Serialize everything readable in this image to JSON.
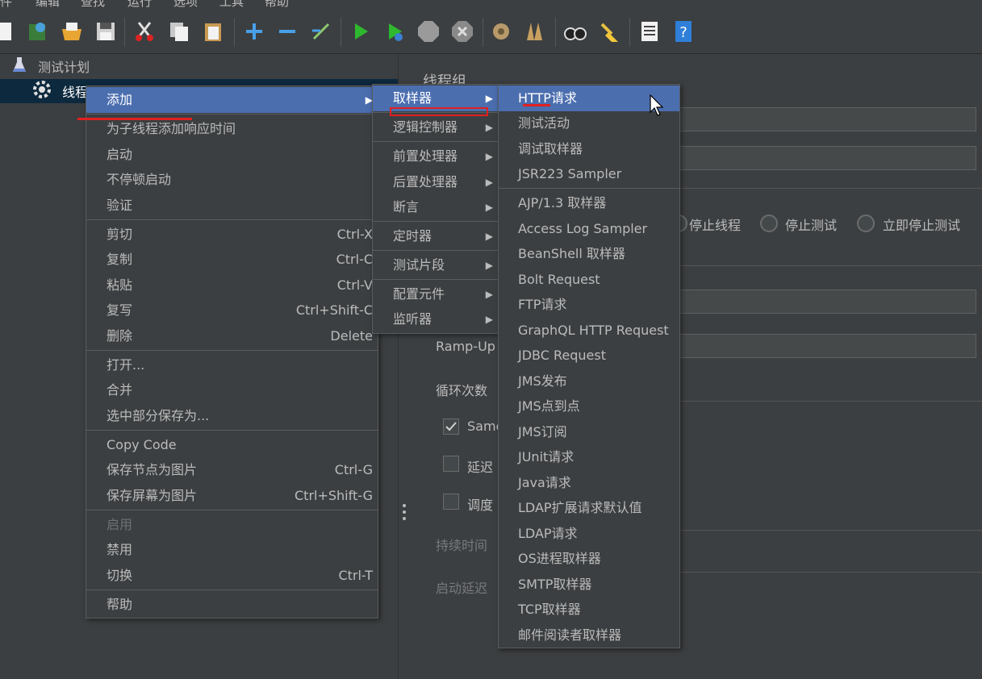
{
  "menubar": [
    "件",
    "编辑",
    "查找",
    "运行",
    "选项",
    "工具",
    "帮助"
  ],
  "toolbar": {
    "icons": [
      "new-icon",
      "templates-icon",
      "open-icon",
      "save-icon",
      "cut-icon",
      "copy-icon",
      "paste-icon",
      "expand-icon",
      "collapse-icon",
      "toggle-icon",
      "start-icon",
      "start-no-pause-icon",
      "stop-icon",
      "shutdown-icon",
      "clear-icon",
      "clear-all-icon",
      "search-icon",
      "reset-search-icon",
      "function-helper-icon",
      "help-icon"
    ]
  },
  "tree": {
    "root_label": "测试计划",
    "child_label": "线程组"
  },
  "right_panel": {
    "title": "线程组",
    "radio_stop_thread": "停止线程",
    "radio_stop_test": "停止测试",
    "radio_stop_test_now": "立即停止测试",
    "ramp_up_label": "Ramp-Up",
    "loop_label": "循环次数",
    "same_user_label": "Same",
    "delay_label": "延迟",
    "scheduler_label": "调度",
    "duration_label": "持续时间",
    "startup_delay_label": "启动延迟"
  },
  "context_menu": {
    "items": [
      {
        "label": "添加",
        "submenu": true,
        "selected": true
      },
      {
        "label": "为子线程添加响应时间"
      },
      {
        "label": "启动"
      },
      {
        "label": "不停顿启动"
      },
      {
        "label": "验证"
      },
      {
        "label": "剪切",
        "shortcut": "Ctrl-X"
      },
      {
        "label": "复制",
        "shortcut": "Ctrl-C"
      },
      {
        "label": "粘贴",
        "shortcut": "Ctrl-V"
      },
      {
        "label": "复写",
        "shortcut": "Ctrl+Shift-C"
      },
      {
        "label": "删除",
        "shortcut": "Delete"
      },
      {
        "label": "打开..."
      },
      {
        "label": "合并"
      },
      {
        "label": "选中部分保存为..."
      },
      {
        "label": "Copy Code"
      },
      {
        "label": "保存节点为图片",
        "shortcut": "Ctrl-G"
      },
      {
        "label": "保存屏幕为图片",
        "shortcut": "Ctrl+Shift-G"
      },
      {
        "label": "启用",
        "disabled": true
      },
      {
        "label": "禁用"
      },
      {
        "label": "切换",
        "shortcut": "Ctrl-T"
      },
      {
        "label": "帮助"
      }
    ]
  },
  "add_submenu": {
    "items": [
      {
        "label": "取样器",
        "selected": true
      },
      {
        "label": "逻辑控制器"
      },
      {
        "label": "前置处理器"
      },
      {
        "label": "后置处理器"
      },
      {
        "label": "断言"
      },
      {
        "label": "定时器"
      },
      {
        "label": "测试片段"
      },
      {
        "label": "配置元件"
      },
      {
        "label": "监听器"
      }
    ]
  },
  "sampler_submenu": {
    "items": [
      {
        "label": "HTTP请求",
        "selected": true
      },
      {
        "label": "测试活动"
      },
      {
        "label": "调试取样器"
      },
      {
        "label": "JSR223 Sampler"
      },
      {
        "label": "AJP/1.3 取样器"
      },
      {
        "label": "Access Log Sampler"
      },
      {
        "label": "BeanShell 取样器"
      },
      {
        "label": "Bolt Request"
      },
      {
        "label": "FTP请求"
      },
      {
        "label": "GraphQL HTTP Request"
      },
      {
        "label": "JDBC Request"
      },
      {
        "label": "JMS发布"
      },
      {
        "label": "JMS点到点"
      },
      {
        "label": "JMS订阅"
      },
      {
        "label": "JUnit请求"
      },
      {
        "label": "Java请求"
      },
      {
        "label": "LDAP扩展请求默认值"
      },
      {
        "label": "LDAP请求"
      },
      {
        "label": "OS进程取样器"
      },
      {
        "label": "SMTP取样器"
      },
      {
        "label": "TCP取样器"
      },
      {
        "label": "邮件阅读者取样器"
      }
    ]
  },
  "colors": {
    "background": "#3c3f41",
    "selection": "#4b6eaf",
    "tree_selection": "#0d293e",
    "annotation_red": "#e02020"
  }
}
